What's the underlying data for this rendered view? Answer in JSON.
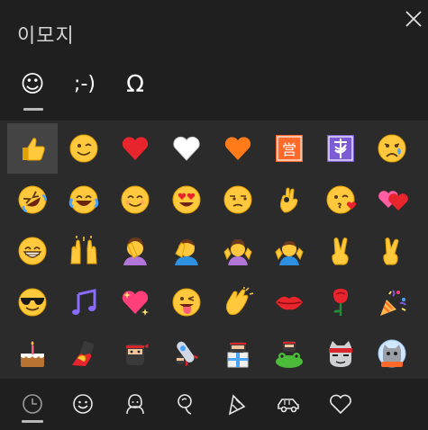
{
  "title": "이모지",
  "tabs": [
    {
      "name": "emoji-tab",
      "glyph": "☺",
      "active": true
    },
    {
      "name": "kaomoji-tab",
      "glyph": ";-)",
      "active": false
    },
    {
      "name": "symbols-tab",
      "glyph": "Ω",
      "active": false
    }
  ],
  "emojis": [
    "thumbs-up",
    "winking-face",
    "red-heart",
    "white-heart",
    "orange-heart",
    "japanese-open-for-business-button",
    "ophiuchus",
    "crying-face",
    "rolling-on-the-floor-laughing",
    "face-with-tears-of-joy",
    "smiling-face-with-smiling-eyes",
    "smiling-face-with-heart-eyes",
    "unamused-face",
    "ok-hand",
    "face-blowing-a-kiss",
    "two-hearts",
    "grinning-face",
    "raising-hands",
    "person-facepalming",
    "man-facepalming",
    "woman-shrugging",
    "man-shrugging",
    "victory-hand",
    "crossed-fingers",
    "smiling-face-with-sunglasses",
    "musical-notes",
    "sparkling-heart",
    "winking-face-with-tongue",
    "clapping-hands",
    "kiss-mark",
    "rose",
    "party-popper",
    "birthday-cake",
    "selfie",
    "ninja",
    "ninja-with-rocket",
    "ninja-with-present",
    "ninja-with-frog",
    "ninja-cat",
    "astronaut-cat"
  ],
  "categories": [
    {
      "name": "recent-icon",
      "active": true
    },
    {
      "name": "smiley-icon"
    },
    {
      "name": "people-icon"
    },
    {
      "name": "food-icon"
    },
    {
      "name": "celebration-icon"
    },
    {
      "name": "car-icon"
    },
    {
      "name": "heart-icon"
    }
  ],
  "colors": {
    "header_bg": "#1f1f1f",
    "grid_bg": "#2b2b2b",
    "selected_bg": "#444444",
    "text": "#d4d4d4"
  }
}
